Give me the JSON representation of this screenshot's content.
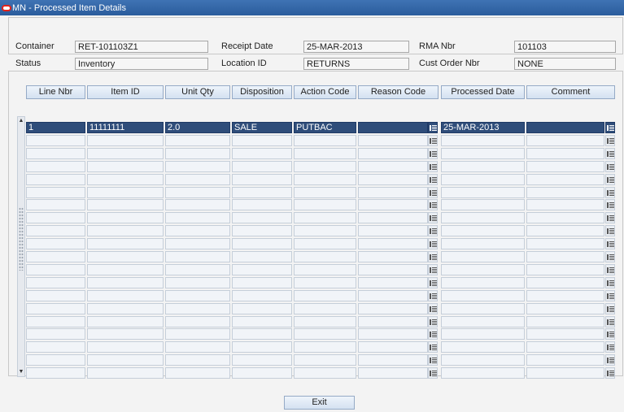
{
  "window": {
    "title": "MN - Processed Item Details"
  },
  "header": {
    "container_label": "Container",
    "container_value": "RET-101103Z1",
    "receipt_date_label": "Receipt Date",
    "receipt_date_value": "25-MAR-2013",
    "rma_nbr_label": "RMA Nbr",
    "rma_nbr_value": "101103",
    "status_label": "Status",
    "status_value": "Inventory",
    "location_id_label": "Location ID",
    "location_id_value": "RETURNS",
    "cust_order_nbr_label": "Cust Order Nbr",
    "cust_order_nbr_value": "NONE"
  },
  "grid": {
    "columns": [
      "Line Nbr",
      "Item ID",
      "Unit Qty",
      "Disposition",
      "Action Code",
      "Reason Code",
      "Processed Date",
      "Comment"
    ],
    "rows": [
      [
        "1",
        "11111111",
        "2.0",
        "SALE",
        "PUTBAC",
        "",
        "25-MAR-2013",
        ""
      ]
    ],
    "visible_row_count": 20
  },
  "footer": {
    "exit_label": "Exit"
  },
  "colors": {
    "selected_row": "#2f4d7a",
    "title_bar": "#2a5c9c"
  }
}
